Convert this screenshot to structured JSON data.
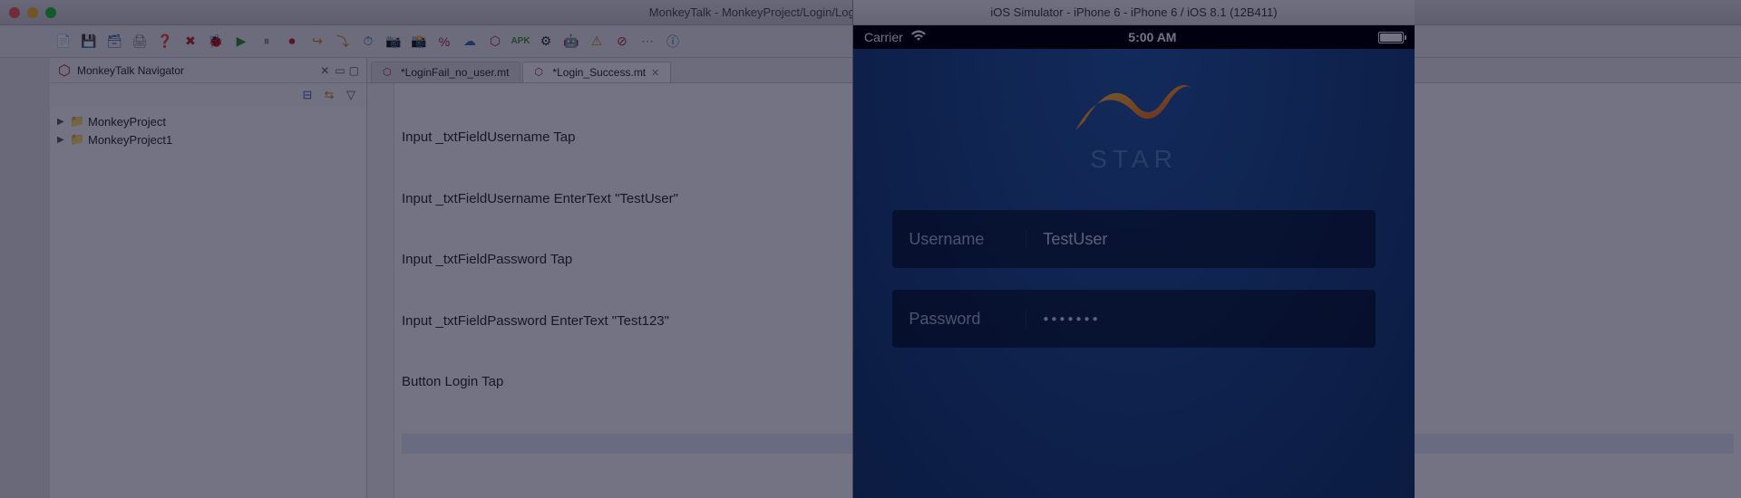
{
  "window": {
    "title": "MonkeyTalk - MonkeyProject/Login/Login_Success.mt - MonkeyTalkIDE Professional"
  },
  "navigator": {
    "title": "MonkeyTalk Navigator",
    "projects": [
      {
        "name": "MonkeyProject"
      },
      {
        "name": "MonkeyProject1"
      }
    ]
  },
  "editor": {
    "tabs": [
      {
        "label": "*LoginFail_no_user.mt",
        "active": false
      },
      {
        "label": "*Login_Success.mt",
        "active": true
      }
    ],
    "lines": [
      "Input _txtFieldUsername Tap",
      "Input _txtFieldUsername EnterText \"TestUser\"",
      "Input _txtFieldPassword Tap",
      "Input _txtFieldPassword EnterText \"Test123\"",
      "Button Login Tap"
    ]
  },
  "simulator": {
    "title": "iOS Simulator - iPhone 6 - iPhone 6 / iOS 8.1 (12B411)",
    "statusbar": {
      "carrier": "Carrier",
      "time": "5:00 AM"
    },
    "app": {
      "brand": "STAR",
      "username_label": "Username",
      "username_value": "TestUser",
      "password_label": "Password",
      "password_value": "●●●●●●●"
    }
  }
}
